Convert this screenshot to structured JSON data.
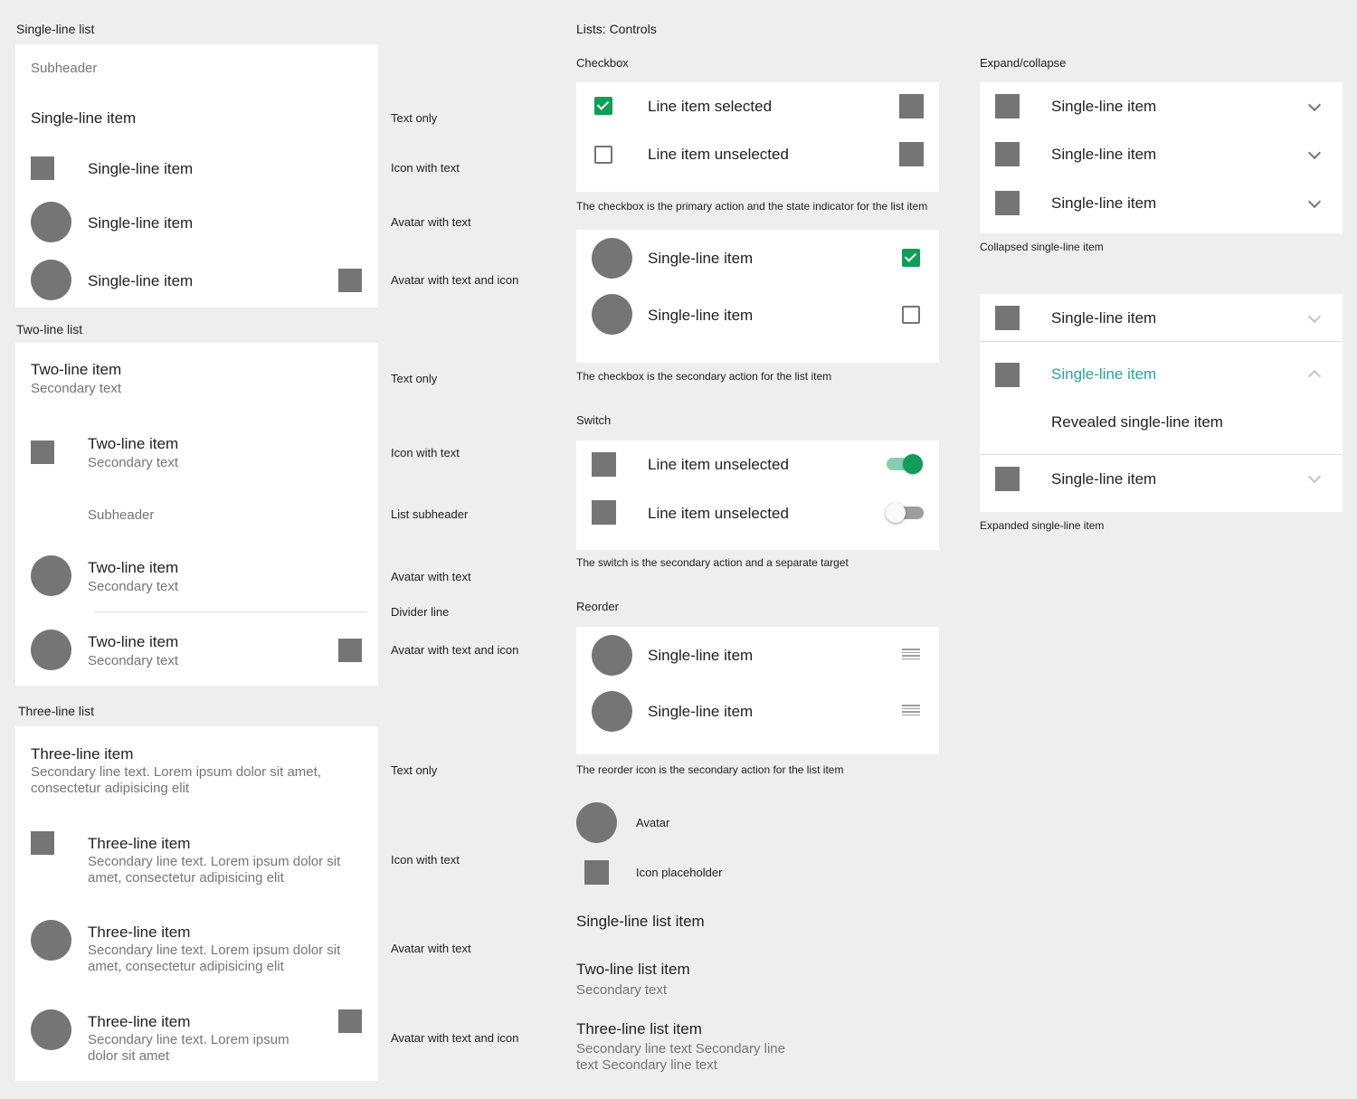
{
  "single": {
    "title": "Single-line list",
    "subheader": "Subheader",
    "items": [
      "Single-line item",
      "Single-line item",
      "Single-line item",
      "Single-line item"
    ],
    "labels": [
      "Text only",
      "Icon with text",
      "Avatar with text",
      "Avatar with text and icon"
    ]
  },
  "two": {
    "title": "Two-line list",
    "item": "Two-line item",
    "secondary": "Secondary text",
    "subheader": "Subheader",
    "labels": [
      "Text only",
      "Icon with text",
      "List subheader",
      "Avatar with text",
      "Divider line",
      "Avatar with text and icon"
    ]
  },
  "three": {
    "title": "Three-line list",
    "item": "Three-line item",
    "sec_a": "Secondary line text. Lorem ipsum dolor sit amet, consectetur adipisicing elit",
    "sec_b": "Secondary line text. Lorem ipsum dolor sit amet, consectetur adipisicing elit",
    "sec_c": "Secondary line text. Lorem ipsum dolor sit amet",
    "labels": [
      "Text only",
      "Icon with text",
      "Avatar with text",
      "Avatar with text and icon"
    ]
  },
  "controls": {
    "title": "Lists: Controls",
    "checkbox_title": "Checkbox",
    "cb_selected": "Line item selected",
    "cb_unselected": "Line item unselected",
    "cb_caption1": "The checkbox is the primary action and the state indicator for the list item",
    "cb_item": "Single-line item",
    "cb_caption2": "The checkbox is the secondary action for the list item",
    "switch_title": "Switch",
    "sw_item": "Line item unselected",
    "sw_caption": "The switch is the secondary action and a separate target",
    "reorder_title": "Reorder",
    "ro_item": "Single-line item",
    "ro_caption": "The reorder icon is the secondary action for the list item",
    "legend_avatar": "Avatar",
    "legend_icon": "Icon placeholder",
    "legend_single": "Single-line list item",
    "legend_two": "Two-line list item",
    "legend_two_sec": "Secondary text",
    "legend_three": "Three-line list item",
    "legend_three_sec": "Secondary line text Secondary line text Secondary line text"
  },
  "expand": {
    "title": "Expand/collapse",
    "item": "Single-line item",
    "collapsed_caption": "Collapsed single-line item",
    "revealed": "Revealed single-line item",
    "expanded_caption": "Expanded single-line item"
  },
  "colors": {
    "accent": "#0f9d58",
    "teal": "#26a69a",
    "placeholder": "#757575"
  }
}
